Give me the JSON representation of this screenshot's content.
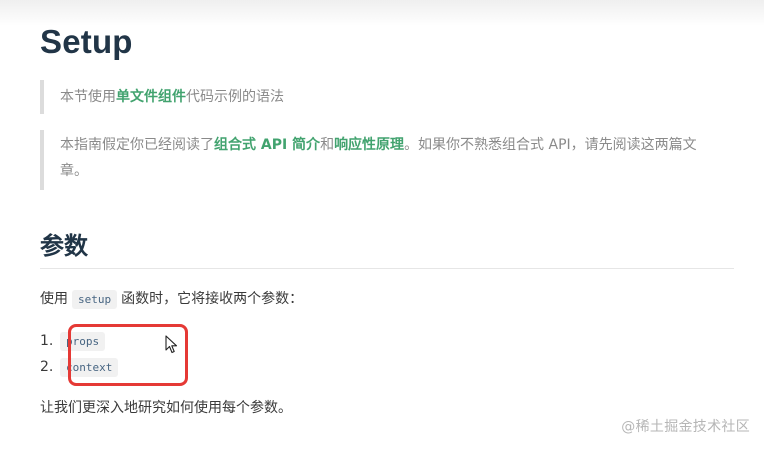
{
  "page": {
    "title": "Setup"
  },
  "tips": {
    "tip1": {
      "before": "本节使用",
      "link": "单文件组件",
      "after": "代码示例的语法"
    },
    "tip2": {
      "before": "本指南假定你已经阅读了",
      "link1": "组合式 API 简介",
      "and": "和",
      "link2": "响应性原理",
      "after": "。如果你不熟悉组合式 API，请先阅读这两篇文章。"
    }
  },
  "section": {
    "title": "参数",
    "intro_before": "使用",
    "intro_code": "setup",
    "intro_after": "函数时，它将接收两个参数：",
    "list": [
      {
        "num": "1.",
        "code": "props"
      },
      {
        "num": "2.",
        "code": "context"
      }
    ],
    "outro": "让我们更深入地研究如何使用每个参数。"
  },
  "watermark": "@稀土掘金技术社区",
  "colors": {
    "accent_link": "#42a36f",
    "highlight_border": "#e53935"
  },
  "icons": {
    "cursor": "mouse-pointer-icon"
  }
}
